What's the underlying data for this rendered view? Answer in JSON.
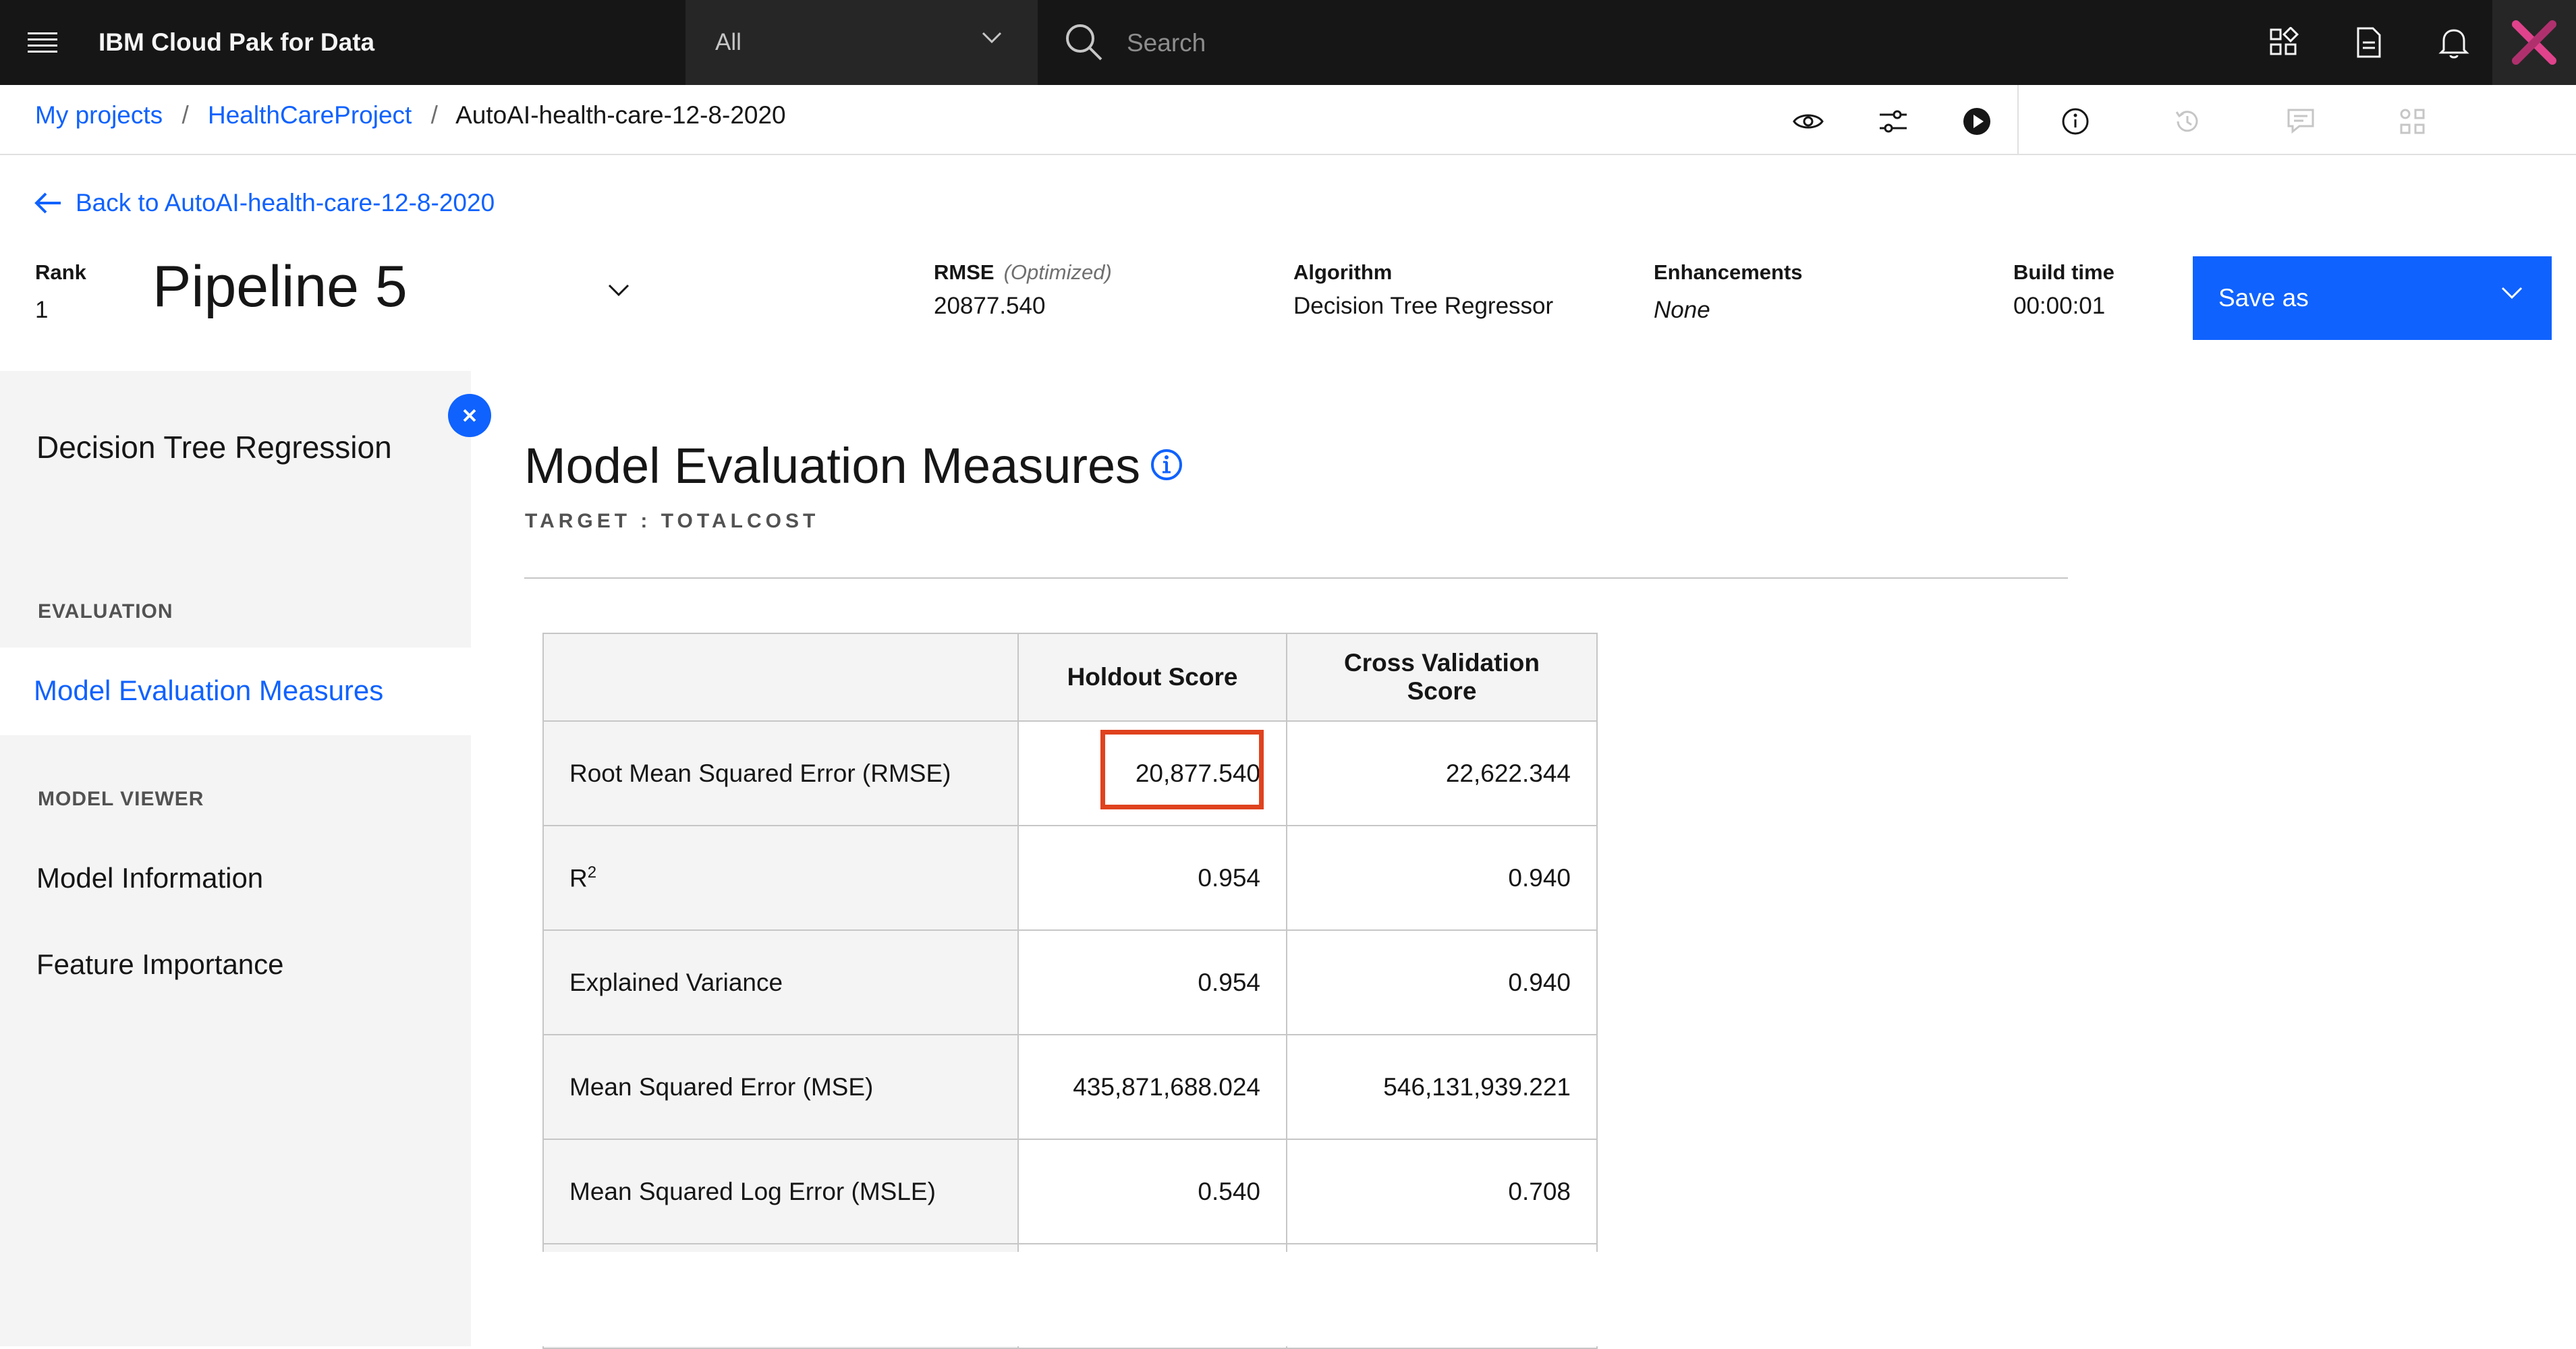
{
  "app": {
    "title": "IBM Cloud Pak for Data",
    "scope_select": "All",
    "search_placeholder": "Search"
  },
  "topbar_icons": [
    "menu-icon",
    "apps-switcher-icon",
    "document-icon",
    "notification-bell-icon",
    "brand-x-icon"
  ],
  "breadcrumb": {
    "items": [
      "My projects",
      "HealthCareProject",
      "AutoAI-health-care-12-8-2020"
    ],
    "separator": "/"
  },
  "toolbar_icons": [
    "view-icon",
    "settings-sliders-icon",
    "run-icon",
    "info-icon",
    "history-icon",
    "comments-icon",
    "nodes-icon"
  ],
  "header": {
    "back_link": "Back to AutoAI-health-care-12-8-2020",
    "rank_label": "Rank",
    "rank_value": "1",
    "pipeline_title": "Pipeline 5",
    "rmse_label": "RMSE",
    "rmse_optimized": "(Optimized)",
    "rmse_value": "20877.540",
    "algorithm_label": "Algorithm",
    "algorithm_value": "Decision Tree Regressor",
    "enhancements_label": "Enhancements",
    "enhancements_value": "None",
    "build_time_label": "Build time",
    "build_time_value": "00:00:01",
    "save_as_label": "Save as"
  },
  "left_panel": {
    "title": "Decision Tree Regression",
    "evaluation_section": "EVALUATION",
    "evaluation_items": [
      "Model Evaluation Measures"
    ],
    "model_viewer_section": "MODEL VIEWER",
    "model_viewer_items": [
      "Model Information",
      "Feature Importance"
    ]
  },
  "main": {
    "title": "Model Evaluation Measures",
    "target": "TARGET : TOTALCOST",
    "table": {
      "headers": [
        "",
        "Holdout Score",
        "Cross Validation Score"
      ],
      "rows": [
        {
          "metric": "Root Mean Squared Error (RMSE)",
          "holdout": "20,877.540",
          "cv": "22,622.344",
          "highlighted": true
        },
        {
          "metric_base": "R",
          "metric_sup": "2",
          "holdout": "0.954",
          "cv": "0.940"
        },
        {
          "metric": "Explained Variance",
          "holdout": "0.954",
          "cv": "0.940"
        },
        {
          "metric": "Mean Squared Error (MSE)",
          "holdout": "435,871,688.024",
          "cv": "546,131,939.221"
        },
        {
          "metric": "Mean Squared Log Error (MSLE)",
          "holdout": "0.540",
          "cv": "0.708"
        }
      ]
    }
  },
  "colors": {
    "topbar": "#161616",
    "accent_blue": "#0f62fe",
    "highlight_red": "#e0421e",
    "panel_gray": "#f4f4f4"
  }
}
